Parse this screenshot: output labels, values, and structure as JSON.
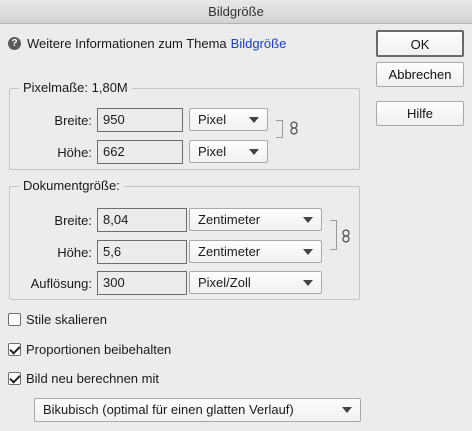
{
  "window": {
    "title": "Bildgröße"
  },
  "help": {
    "text": "Weitere Informationen zum Thema",
    "link": "Bildgröße"
  },
  "buttons": {
    "ok": "OK",
    "cancel": "Abbrechen",
    "help": "Hilfe"
  },
  "pixel_dimensions": {
    "legend": "Pixelmaße: 1,80M",
    "width": {
      "label": "Breite:",
      "value": "950",
      "unit": "Pixel"
    },
    "height": {
      "label": "Höhe:",
      "value": "662",
      "unit": "Pixel"
    }
  },
  "document_size": {
    "legend": "Dokumentgröße:",
    "width": {
      "label": "Breite:",
      "value": "8,04",
      "unit": "Zentimeter"
    },
    "height": {
      "label": "Höhe:",
      "value": "5,6",
      "unit": "Zentimeter"
    },
    "resolution": {
      "label": "Auflösung:",
      "value": "300",
      "unit": "Pixel/Zoll"
    }
  },
  "options": {
    "scale_styles": {
      "label": "Stile skalieren",
      "checked": false
    },
    "constrain_proportions": {
      "label": "Proportionen beibehalten",
      "checked": true
    },
    "resample": {
      "label": "Bild neu berechnen mit",
      "checked": true
    }
  },
  "resample_method": "Bikubisch (optimal für einen glatten Verlauf)"
}
